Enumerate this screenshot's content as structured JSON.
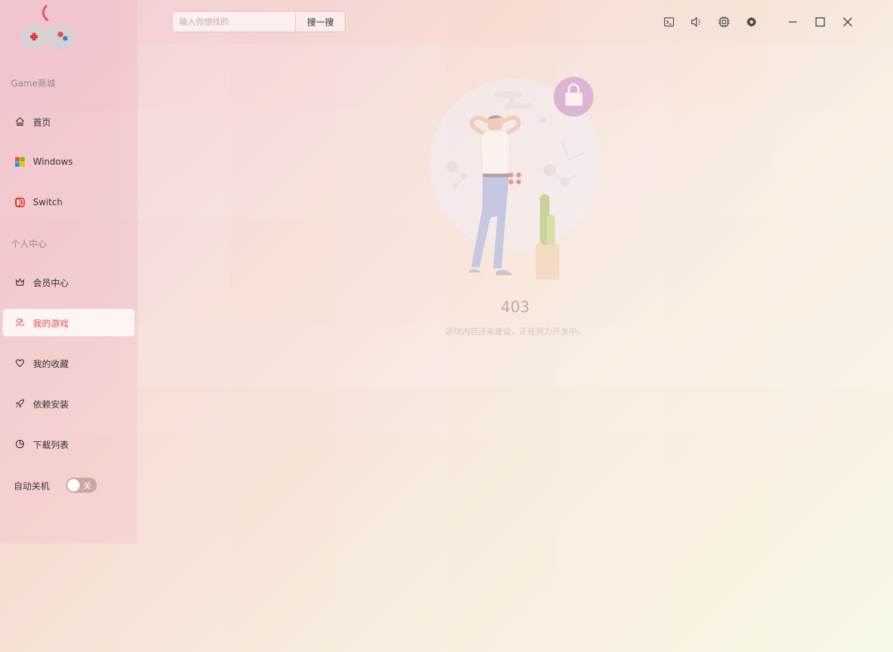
{
  "app": {
    "logo_icon": "gamepad-logo-icon"
  },
  "search": {
    "placeholder": "输入你想找的",
    "button_label": "搜一搜"
  },
  "toolbar": {
    "icons": [
      "terminal-icon",
      "volume-icon",
      "chip-icon",
      "gear-icon"
    ],
    "window_controls": [
      "minimize-icon",
      "maximize-icon",
      "close-icon"
    ]
  },
  "sidebar": {
    "section1_title": "Game商城",
    "section2_title": "个人中心",
    "items": [
      {
        "label": "首页",
        "icon": "home-icon"
      },
      {
        "label": "Windows",
        "icon": "windows-icon"
      },
      {
        "label": "Switch",
        "icon": "switch-icon"
      },
      {
        "label": "会员中心",
        "icon": "crown-icon"
      },
      {
        "label": "我的游戏",
        "icon": "user-group-icon",
        "active": true
      },
      {
        "label": "我的收藏",
        "icon": "heart-icon"
      },
      {
        "label": "依赖安装",
        "icon": "rocket-icon"
      },
      {
        "label": "下载列表",
        "icon": "pie-chart-icon"
      }
    ],
    "auto_shutdown": {
      "label": "自动关机",
      "state_text": "关",
      "enabled": false
    }
  },
  "error": {
    "code": "403",
    "message": "这块内容还未建设，正在努力开发中。"
  },
  "colors": {
    "accent": "#e0505e",
    "toggle_off": "#c9a6a2"
  }
}
